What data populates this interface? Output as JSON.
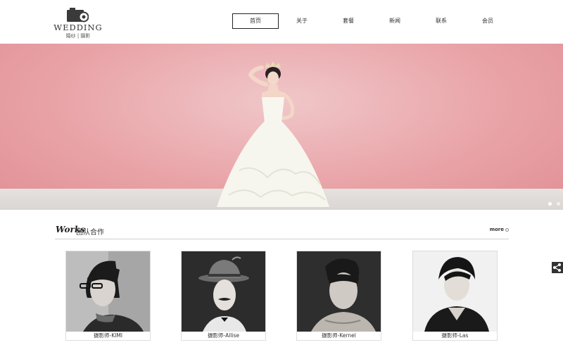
{
  "logo": {
    "word": "WEDDING",
    "sub": "婚纱 | 摄影",
    "icon": "camera-icon"
  },
  "nav": [
    {
      "label": "首页",
      "active": true
    },
    {
      "label": "关于",
      "active": false
    },
    {
      "label": "套餐",
      "active": false
    },
    {
      "label": "新闻",
      "active": false
    },
    {
      "label": "联系",
      "active": false
    },
    {
      "label": "会员",
      "active": false
    }
  ],
  "banner": {
    "slides": 2,
    "active_slide": 1,
    "colors": {
      "backdrop": "#e9a4a8",
      "floor": "#ddd9d6"
    }
  },
  "section": {
    "en_title": "Works",
    "cn_title": "团队合作",
    "more_label": "more"
  },
  "team": [
    {
      "caption": "摄影师-KIMI"
    },
    {
      "caption": "摄影师-Allise"
    },
    {
      "caption": "摄影师-Kernel"
    },
    {
      "caption": "摄影师-Las"
    }
  ],
  "share": {
    "icon": "share-icon"
  }
}
